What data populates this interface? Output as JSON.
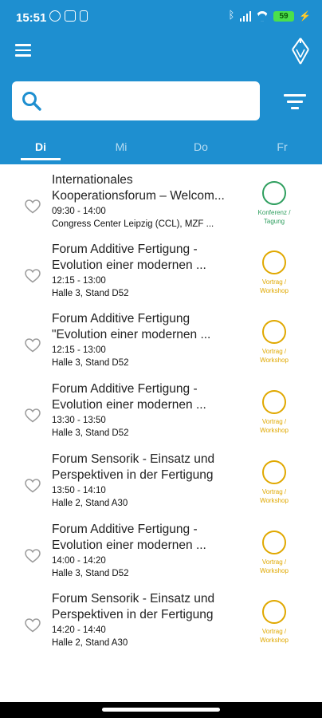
{
  "status_bar": {
    "time": "15:51",
    "battery": "59"
  },
  "search": {
    "placeholder": "",
    "value": ""
  },
  "tabs": [
    {
      "label": "Di"
    },
    {
      "label": "Mi"
    },
    {
      "label": "Do"
    },
    {
      "label": "Fr"
    }
  ],
  "colors": {
    "appbar": "#1e8fd0",
    "konferenz": "#2e9e5e",
    "vortrag": "#e0a800"
  },
  "events": [
    {
      "title1": "Internationales",
      "title2": "Kooperationsforum – Welcom...",
      "time": "09:30 - 14:00",
      "location": " Congress Center Leipzig (CCL), MZF ...",
      "type_line1": "Konferenz /",
      "type_line2": "Tagung",
      "type": "konferenz"
    },
    {
      "title1": "Forum Additive Fertigung -",
      "title2": "Evolution einer modernen ...",
      "time": "12:15 - 13:00",
      "location": "Halle 3, Stand D52",
      "type_line1": "Vortrag /",
      "type_line2": "Workshop",
      "type": "vortrag"
    },
    {
      "title1": "Forum Additive Fertigung",
      "title2": "\"Evolution einer modernen ...",
      "time": "12:15 - 13:00",
      "location": "Halle 3, Stand D52",
      "type_line1": "Vortrag /",
      "type_line2": "Workshop",
      "type": "vortrag"
    },
    {
      "title1": "Forum Additive Fertigung -",
      "title2": "Evolution einer modernen ...",
      "time": "13:30 - 13:50",
      "location": "Halle 3, Stand D52",
      "type_line1": "Vortrag /",
      "type_line2": "Workshop",
      "type": "vortrag"
    },
    {
      "title1": "Forum Sensorik - Einsatz und",
      "title2": "Perspektiven in der Fertigung",
      "time": "13:50 - 14:10",
      "location": "Halle 2, Stand A30",
      "type_line1": "Vortrag /",
      "type_line2": "Workshop",
      "type": "vortrag"
    },
    {
      "title1": "Forum Additive Fertigung -",
      "title2": "Evolution einer modernen ...",
      "time": "14:00 - 14:20",
      "location": "Halle 3, Stand D52",
      "type_line1": "Vortrag /",
      "type_line2": "Workshop",
      "type": "vortrag"
    },
    {
      "title1": "Forum Sensorik - Einsatz und",
      "title2": "Perspektiven in der Fertigung",
      "time": "14:20 - 14:40",
      "location": "Halle 2, Stand A30",
      "type_line1": "Vortrag /",
      "type_line2": "Workshop",
      "type": "vortrag"
    }
  ]
}
